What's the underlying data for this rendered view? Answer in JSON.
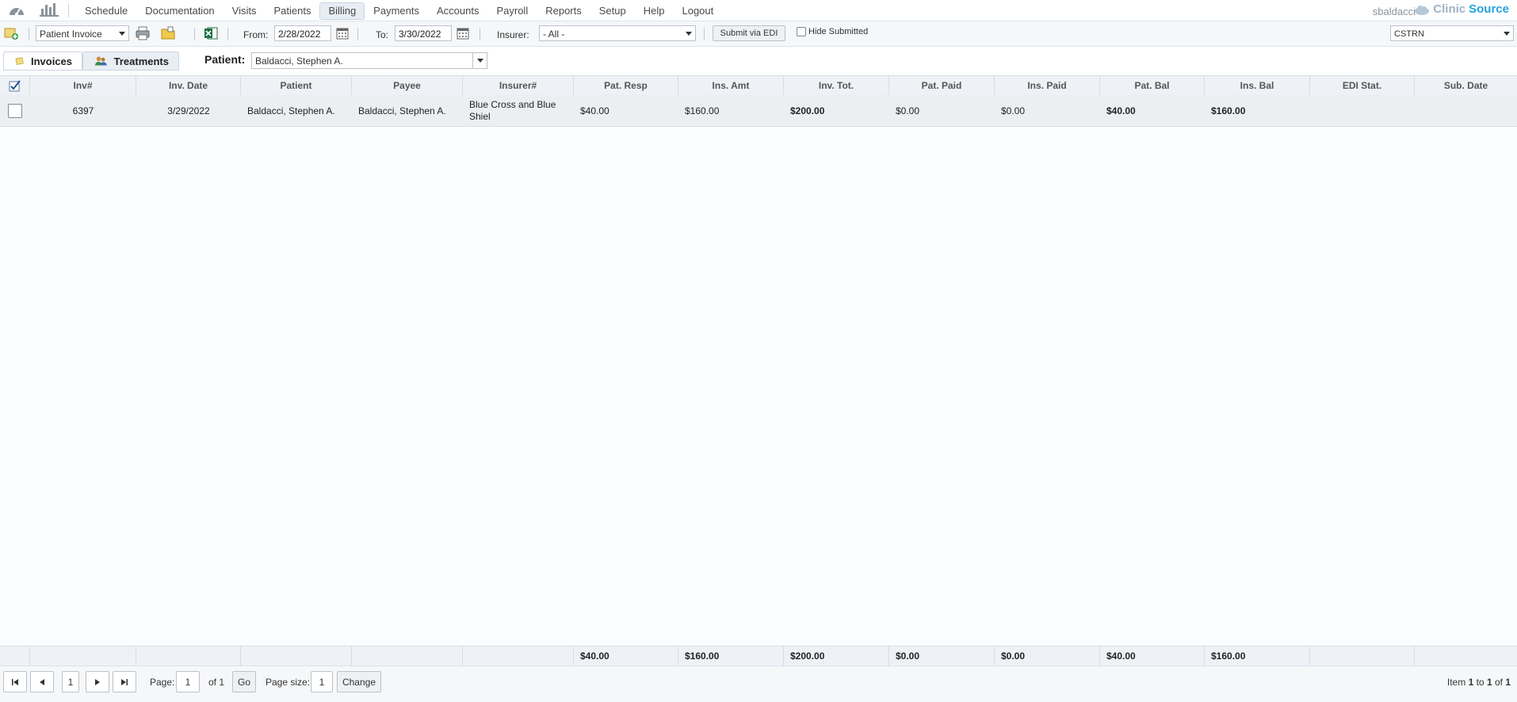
{
  "nav": {
    "items": [
      "Schedule",
      "Documentation",
      "Visits",
      "Patients",
      "Billing",
      "Payments",
      "Accounts",
      "Payroll",
      "Reports",
      "Setup",
      "Help",
      "Logout"
    ],
    "active": "Billing",
    "user": "sbaldacci",
    "brand_a": "Clinic",
    "brand_b": "Source"
  },
  "toolbar": {
    "report_select": "Patient Invoice",
    "from_label": "From:",
    "from_value": "2/28/2022",
    "to_label": "To:",
    "to_value": "3/30/2022",
    "insurer_label": "Insurer:",
    "insurer_value": "- All -",
    "submit_edi": "Submit via EDI",
    "hide_submitted": "Hide Submitted",
    "location_value": "CSTRN"
  },
  "tabs": {
    "invoices": "Invoices",
    "treatments": "Treatments",
    "patient_label": "Patient:",
    "patient_value": "Baldacci, Stephen A."
  },
  "grid": {
    "headers": [
      "Inv#",
      "Inv. Date",
      "Patient",
      "Payee",
      "Insurer#",
      "Pat. Resp",
      "Ins. Amt",
      "Inv. Tot.",
      "Pat. Paid",
      "Ins. Paid",
      "Pat. Bal",
      "Ins. Bal",
      "EDI Stat.",
      "Sub. Date"
    ],
    "rows": [
      {
        "inv": "6397",
        "date": "3/29/2022",
        "patient": "Baldacci, Stephen A.",
        "payee": "Baldacci, Stephen A.",
        "insurer": "Blue Cross and Blue Shiel",
        "pat_resp": "$40.00",
        "ins_amt": "$160.00",
        "inv_tot": "$200.00",
        "pat_paid": "$0.00",
        "ins_paid": "$0.00",
        "pat_bal": "$40.00",
        "ins_bal": "$160.00",
        "edi": "",
        "sub_date": ""
      }
    ],
    "totals": {
      "pat_resp": "$40.00",
      "ins_amt": "$160.00",
      "inv_tot": "$200.00",
      "pat_paid": "$0.00",
      "ins_paid": "$0.00",
      "pat_bal": "$40.00",
      "ins_bal": "$160.00"
    }
  },
  "pager": {
    "current_page_btn": "1",
    "page_label": "Page:",
    "page_value": "1",
    "of_label": "of 1",
    "go": "Go",
    "size_label": "Page size:",
    "size_value": "1",
    "change": "Change",
    "item_prefix": "Item ",
    "item_from": "1",
    "item_to_label": " to ",
    "item_to": "1",
    "item_of_label": " of ",
    "item_total": "1"
  }
}
